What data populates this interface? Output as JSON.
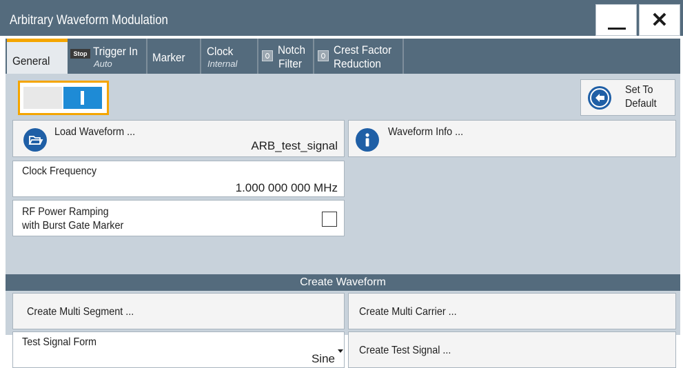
{
  "window": {
    "title": "Arbitrary Waveform Modulation",
    "minimize_icon": "minimize-icon",
    "close_icon": "close-icon",
    "close_glyph": "✕"
  },
  "tabs": [
    {
      "label": "General",
      "active": true
    },
    {
      "label": "Trigger In",
      "sub": "Auto",
      "badge": "Stop"
    },
    {
      "label": "Marker"
    },
    {
      "label": "Clock",
      "sub": "Internal"
    },
    {
      "label_line1": "Notch",
      "label_line2": "Filter",
      "led": "off"
    },
    {
      "label_line1": "Crest Factor",
      "label_line2": "Reduction",
      "led": "off"
    }
  ],
  "state_toggle": {
    "on": true
  },
  "set_to_default": {
    "line1": "Set To",
    "line2": "Default",
    "icon": "arrow-left-icon"
  },
  "load_waveform": {
    "label": "Load Waveform ...",
    "value": "ARB_test_signal",
    "icon": "folder-open-icon"
  },
  "waveform_info": {
    "label": "Waveform Info ...",
    "icon": "info-icon"
  },
  "clock_frequency": {
    "label": "Clock Frequency",
    "value": "1.000 000 000 MHz"
  },
  "rf_power_ramping": {
    "line1": "RF Power Ramping",
    "line2": "with Burst Gate Marker",
    "checked": false
  },
  "create_waveform": {
    "header": "Create Waveform",
    "multi_segment": "Create Multi Segment ...",
    "multi_carrier": "Create Multi Carrier ...",
    "test_signal_form": {
      "label": "Test Signal Form",
      "value": "Sine"
    },
    "test_signal": "Create Test Signal ..."
  },
  "colors": {
    "accent": "#f4a500",
    "header": "#546b7d",
    "toggle_on": "#1e8bd6",
    "icon": "#1f5fa6"
  }
}
